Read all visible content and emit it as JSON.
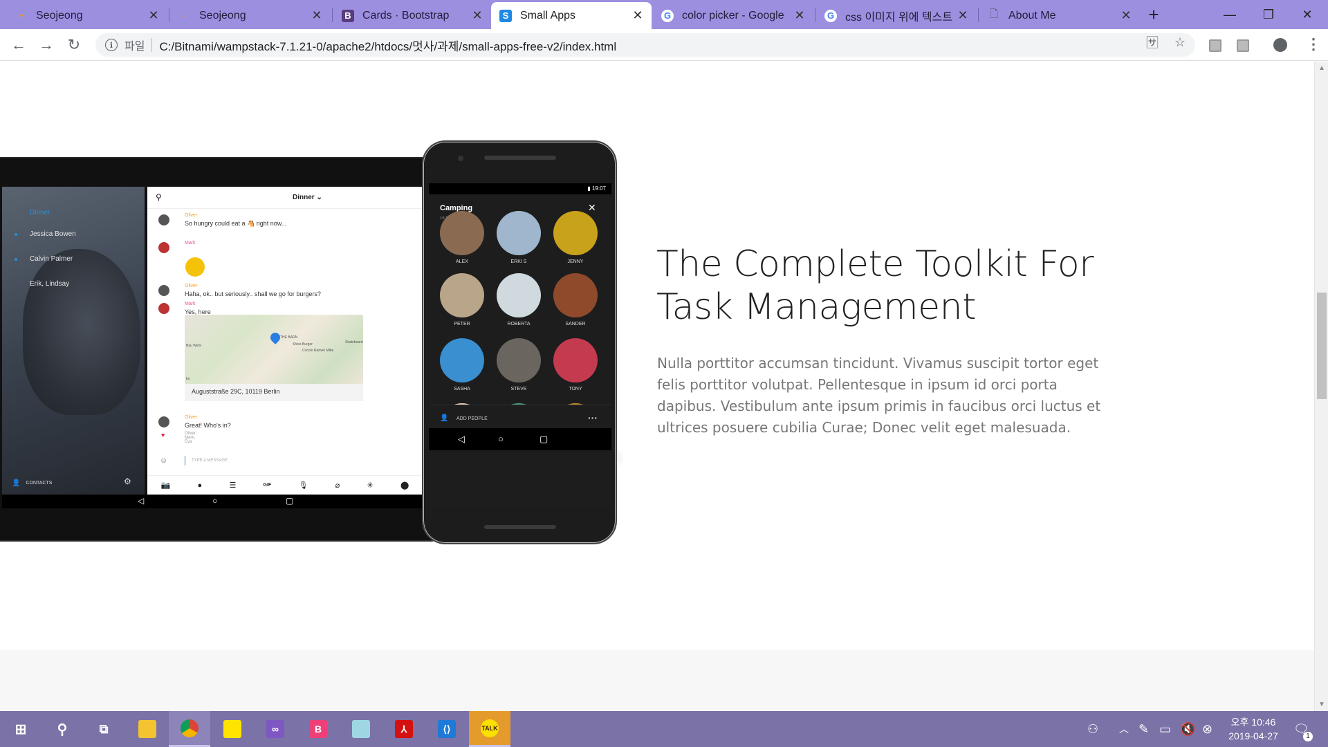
{
  "browser": {
    "tabs": [
      {
        "title": "Seojeong",
        "favicon": "seojeong-logo-icon",
        "active": false
      },
      {
        "title": "Seojeong",
        "favicon": "seojeong-logo-icon",
        "active": false
      },
      {
        "title": "Cards · Bootstrap",
        "favicon": "bootstrap-b-icon",
        "active": false
      },
      {
        "title": "Small Apps",
        "favicon": "small-apps-s-icon",
        "active": true
      },
      {
        "title": "color picker - Google",
        "favicon": "google-g-icon",
        "active": false
      },
      {
        "title": "css 이미지 위에 텍스트",
        "favicon": "google-g-icon",
        "active": false
      },
      {
        "title": "About Me",
        "favicon": "document-icon",
        "active": false
      }
    ],
    "address": {
      "scheme_label": "파일",
      "url": "C:/Bitnami/wampstack-7.1.21-0/apache2/htdocs/멋사/과제/small-apps-free-v2/index.html"
    }
  },
  "page": {
    "hero_title": "The Complete Toolkit For Task Management",
    "hero_text": "Nulla porttitor accumsan tincidunt. Vivamus suscipit tortor eget felis porttitor volutpat. Pellentesque in ipsum id orci porta dapibus. Vestibulum ante ipsum primis in faucibus orci luctus et ultrices posuere cubilia Curae; Donec velit eget malesuada."
  },
  "tablet": {
    "sidebar": {
      "active": "Dinner",
      "contacts": [
        "Jessica Bowen",
        "Calvin Palmer",
        "Erik, Lindsay"
      ],
      "footer_label": "CONTACTS"
    },
    "chat": {
      "title": "Dinner",
      "messages": [
        {
          "name": "Oliver",
          "text": "So hungry could eat a 🐴 right now...",
          "name_color": "#f0a020"
        },
        {
          "name": "Mark",
          "text": "",
          "name_color": "#e0569a"
        },
        {
          "name": "Oliver",
          "text": "Haha, ok.. but seriously.. shall we go for burgers?",
          "name_color": "#f0a020"
        },
        {
          "name": "Mark",
          "text": "Yes, here",
          "name_color": "#e0569a"
        },
        {
          "name": "Oliver",
          "text": "Great! Who's in?",
          "name_color": "#f0a020"
        }
      ],
      "map_caption": "Auguststraße 29C, 10119 Berlin",
      "map_labels": {
        "barn": "THE BARN",
        "burger": "Shiso Burger",
        "ramen": "Cocolo Ramen Mitte",
        "skateboard": "Skateboard",
        "bau": "Bau Werk",
        "for": "for"
      },
      "participants": "Oliver, Mark, Eva",
      "compose_placeholder": "TYPE A MESSAGE",
      "toolbar_icons": [
        "camera-icon",
        "record-icon",
        "stack-icon",
        "gif-icon",
        "mic-icon",
        "attach-icon",
        "sparkle-icon",
        "location-icon"
      ],
      "gif_label": "GIF"
    }
  },
  "phone": {
    "time": "19:07",
    "group_title": "Camping",
    "people_count": "16 PEOPLE",
    "people": [
      {
        "name": "ALEX",
        "color": "#8a6b52"
      },
      {
        "name": "ERKI S",
        "color": "#9fb6cc"
      },
      {
        "name": "JENNY",
        "color": "#c9a21b"
      },
      {
        "name": "PETER",
        "color": "#b8a58a"
      },
      {
        "name": "ROBERTA",
        "color": "#cfd9de"
      },
      {
        "name": "SANDER",
        "color": "#8e4a2a"
      },
      {
        "name": "SASHA",
        "color": "#3a8fd0"
      },
      {
        "name": "STEVE",
        "color": "#6b6560"
      },
      {
        "name": "TONY",
        "color": "#c43b4f"
      },
      {
        "name": "",
        "color": "#e6d0bf"
      },
      {
        "name": "",
        "color": "#4f9a7a"
      },
      {
        "name": "",
        "color": "#c98a3a"
      }
    ],
    "add_label": "ADD PEOPLE"
  },
  "taskbar": {
    "clock_line1": "오후 10:46",
    "clock_line2": "2019-04-27",
    "notification_count": "1",
    "apps": [
      "start-windows-icon",
      "search-icon",
      "task-view-icon",
      "file-explorer-icon",
      "chrome-icon",
      "sticky-notes-icon",
      "visual-studio-icon",
      "bootstrap-studio-icon",
      "notepad-icon",
      "acrobat-icon",
      "vscode-icon",
      "kakaotalk-icon"
    ],
    "kakao_label": "TALK"
  }
}
